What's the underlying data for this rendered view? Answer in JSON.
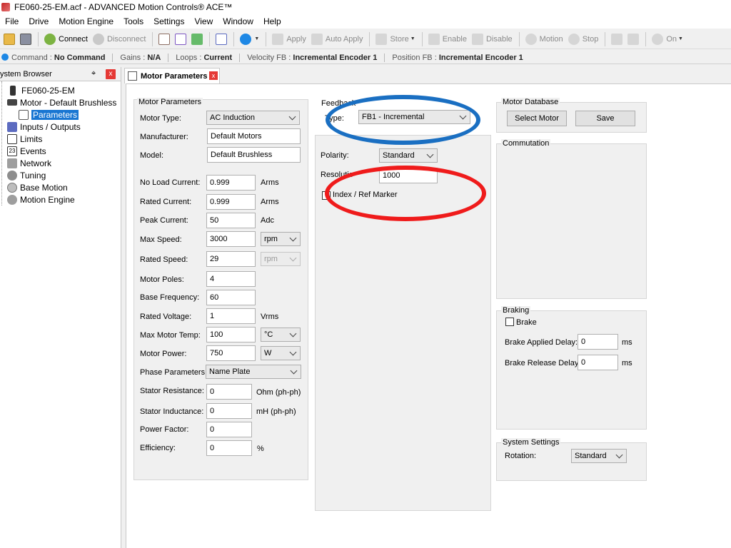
{
  "window": {
    "title": "FE060-25-EM.acf - ADVANCED Motion Controls® ACE™"
  },
  "menu": [
    "File",
    "Drive",
    "Motion Engine",
    "Tools",
    "Settings",
    "View",
    "Window",
    "Help"
  ],
  "toolbar": {
    "connect": "Connect",
    "disconnect": "Disconnect",
    "apply": "Apply",
    "auto_apply": "Auto Apply",
    "store": "Store",
    "enable": "Enable",
    "disable": "Disable",
    "motion": "Motion",
    "stop": "Stop",
    "on": "On"
  },
  "status": {
    "command_label": "Command :",
    "command_value": "No Command",
    "gains_label": "Gains :",
    "gains_value": "N/A",
    "loops_label": "Loops :",
    "loops_value": "Current",
    "velfb_label": "Velocity FB :",
    "velfb_value": "Incremental Encoder 1",
    "posfb_label": "Position FB :",
    "posfb_value": "Incremental Encoder 1"
  },
  "sidebar": {
    "title": "ystem Browser",
    "pin": "⌖",
    "close": "x",
    "items": [
      {
        "label": "FE060-25-EM",
        "icon": "drive-icon"
      },
      {
        "label": "Motor - Default Brushless",
        "icon": "motor-icon"
      },
      {
        "label": "Parameters",
        "icon": "parameters-icon"
      },
      {
        "label": "Inputs / Outputs",
        "icon": "io-icon"
      },
      {
        "label": "Limits",
        "icon": "limits-icon"
      },
      {
        "label": "Events",
        "icon": "calendar-icon",
        "badge": "23"
      },
      {
        "label": "Network",
        "icon": "network-icon"
      },
      {
        "label": "Tuning",
        "icon": "tuning-icon"
      },
      {
        "label": "Base Motion",
        "icon": "gear-icon"
      },
      {
        "label": "Motion Engine",
        "icon": "motion-engine-icon"
      }
    ]
  },
  "tab": {
    "label": "Motor Parameters",
    "close": "x"
  },
  "motor_params": {
    "title": "Motor Parameters",
    "motor_type": {
      "label": "Motor Type:",
      "value": "AC Induction"
    },
    "manufacturer": {
      "label": "Manufacturer:",
      "value": "Default Motors"
    },
    "model": {
      "label": "Model:",
      "value": "Default Brushless"
    },
    "no_load_current": {
      "label": "No Load Current:",
      "value": "0.999",
      "unit": "Arms"
    },
    "rated_current": {
      "label": "Rated Current:",
      "value": "0.999",
      "unit": "Arms"
    },
    "peak_current": {
      "label": "Peak Current:",
      "value": "50",
      "unit": "Adc"
    },
    "max_speed": {
      "label": "Max Speed:",
      "value": "3000",
      "unit": "rpm"
    },
    "rated_speed": {
      "label": "Rated Speed:",
      "value": "29",
      "unit": "rpm"
    },
    "motor_poles": {
      "label": "Motor Poles:",
      "value": "4"
    },
    "base_frequency": {
      "label": "Base Frequency:",
      "value": "60"
    },
    "rated_voltage": {
      "label": "Rated Voltage:",
      "value": "1",
      "unit": "Vrms"
    },
    "max_motor_temp": {
      "label": "Max Motor Temp:",
      "value": "100",
      "unit": "°C"
    },
    "motor_power": {
      "label": "Motor Power:",
      "value": "750",
      "unit": "W"
    },
    "phase_parameters": {
      "label": "Phase Parameters:",
      "value": "Name Plate"
    },
    "stator_resistance": {
      "label": "Stator Resistance:",
      "value": "0",
      "unit": "Ohm (ph-ph)"
    },
    "stator_inductance": {
      "label": "Stator Inductance:",
      "value": "0",
      "unit": "mH (ph-ph)"
    },
    "power_factor": {
      "label": "Power Factor:",
      "value": "0"
    },
    "efficiency": {
      "label": "Efficiency:",
      "value": "0",
      "unit": "%"
    }
  },
  "feedback": {
    "title": "Feedback",
    "type": {
      "label": "Type:",
      "value": "FB1 - Incremental"
    },
    "polarity": {
      "label": "Polarity:",
      "value": "Standard"
    },
    "resolution": {
      "label": "Resolutio",
      "value": "1000"
    },
    "index_marker": {
      "label": "Index / Ref Marker",
      "checked": false
    }
  },
  "motor_database": {
    "title": "Motor Database",
    "select": "Select Motor",
    "save": "Save"
  },
  "commutation": {
    "title": "Commutation"
  },
  "braking": {
    "title": "Braking",
    "brake": {
      "label": "Brake",
      "checked": false
    },
    "applied_delay": {
      "label": "Brake Applied Delay:",
      "value": "0",
      "unit": "ms"
    },
    "release_delay": {
      "label": "Brake Release Delay:",
      "value": "0",
      "unit": "ms"
    }
  },
  "system_settings": {
    "title": "System Settings",
    "rotation": {
      "label": "Rotation:",
      "value": "Standard"
    }
  },
  "colors": {
    "accent_blue": "#1976d2",
    "annotation_blue": "#1a6fc2",
    "annotation_red": "#ef1b1b",
    "close_red": "#e53935"
  }
}
